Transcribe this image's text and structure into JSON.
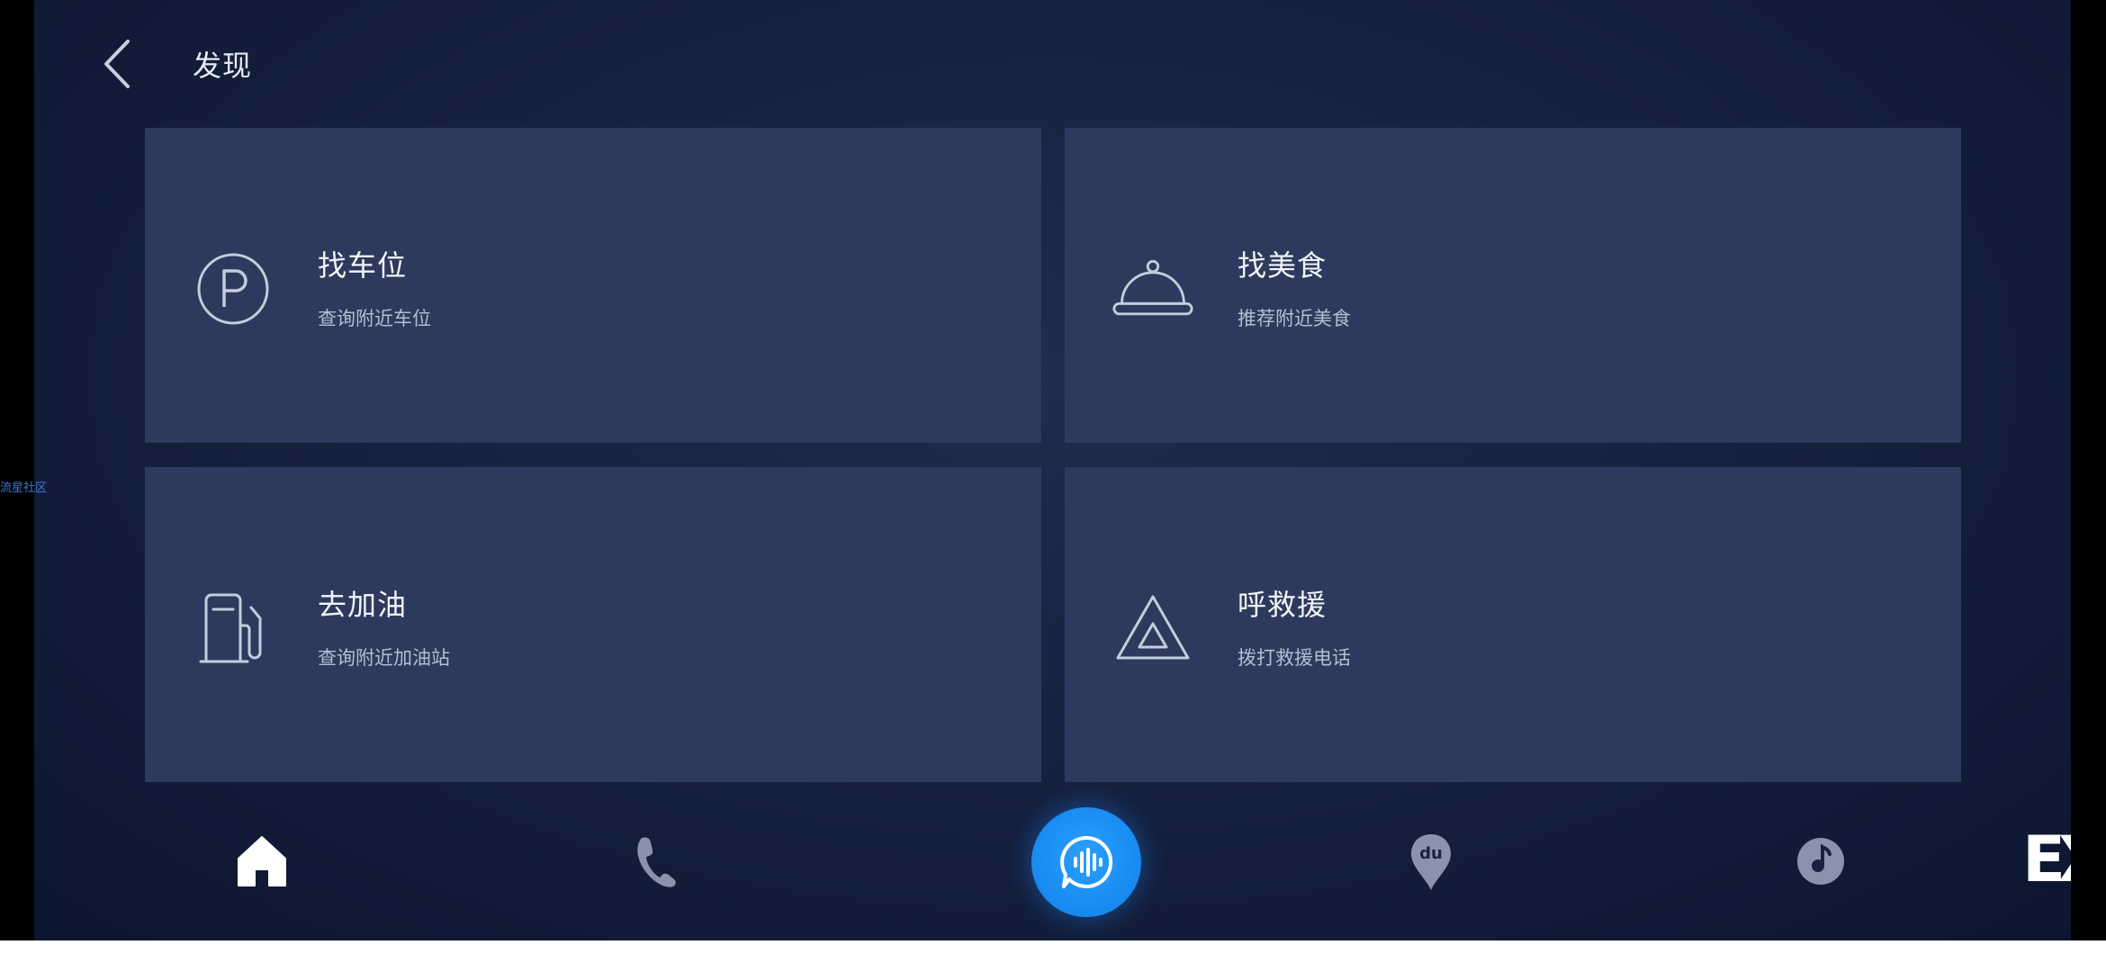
{
  "header": {
    "title": "发现",
    "back_icon": "chevron-left-icon"
  },
  "cards": [
    {
      "title": "找车位",
      "subtitle": "查询附近车位",
      "icon": "parking-icon"
    },
    {
      "title": "找美食",
      "subtitle": "推荐附近美食",
      "icon": "food-cloche-icon"
    },
    {
      "title": "去加油",
      "subtitle": "查询附近加油站",
      "icon": "fuel-pump-icon"
    },
    {
      "title": "呼救援",
      "subtitle": "拨打救援电话",
      "icon": "warning-triangle-icon"
    }
  ],
  "dock": {
    "items": [
      "home-icon",
      "phone-icon",
      "voice-assistant-icon",
      "map-pin-icon",
      "music-icon"
    ],
    "logo_text": "EX",
    "voice_color": "#1a8cf2"
  },
  "side_label": "流星社区",
  "colors": {
    "background": "#172241",
    "card": "#2d3a5e",
    "accent": "#1a8cf2"
  }
}
